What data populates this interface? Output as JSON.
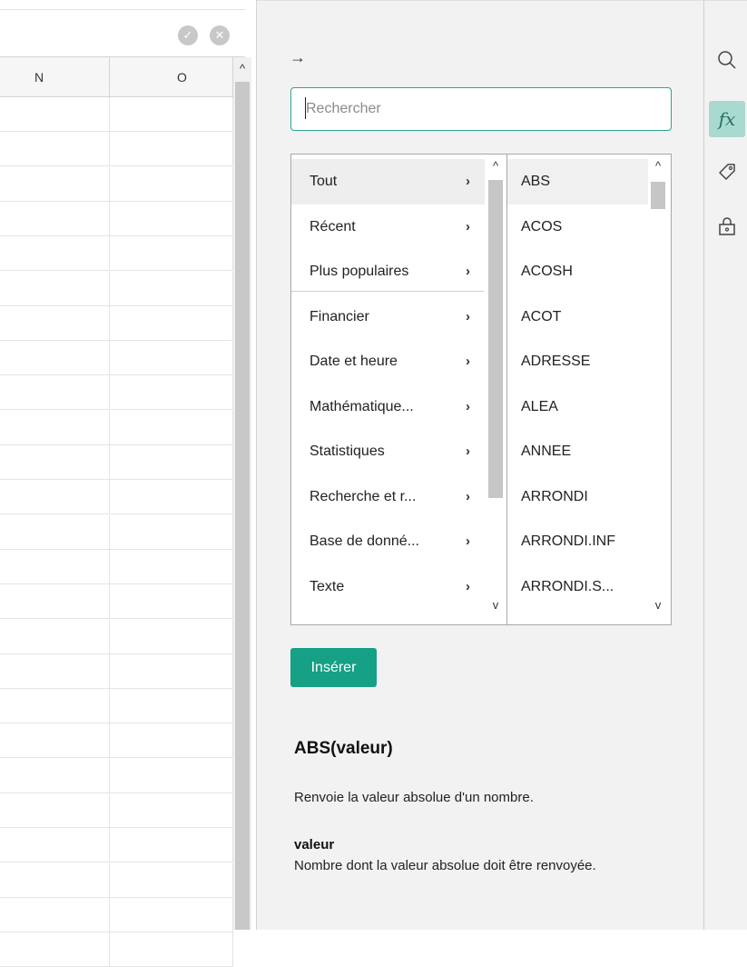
{
  "sheet": {
    "columns": [
      "N",
      "O"
    ]
  },
  "panel": {
    "collapse_icon": "→",
    "search": {
      "placeholder": "Rechercher",
      "value": ""
    },
    "categories": [
      {
        "label": "Tout",
        "selected": true
      },
      {
        "label": "Récent"
      },
      {
        "label": "Plus populaires"
      },
      {
        "label": "Financier"
      },
      {
        "label": "Date et heure"
      },
      {
        "label": "Mathématique..."
      },
      {
        "label": "Statistiques"
      },
      {
        "label": "Recherche et r..."
      },
      {
        "label": "Base de donné..."
      },
      {
        "label": "Texte"
      }
    ],
    "functions": [
      "ABS",
      "ACOS",
      "ACOSH",
      "ACOT",
      "ADRESSE",
      "ALEA",
      "ANNEE",
      "ARRONDI",
      "ARRONDI.INF",
      "ARRONDI.S..."
    ],
    "selected_function": "ABS",
    "insert_label": "Insérer",
    "details": {
      "signature": "ABS(valeur)",
      "description": "Renvoie la valeur absolue d'un nombre.",
      "param_name": "valeur",
      "param_description": "Nombre dont la valeur absolue doit être renvoyée."
    }
  },
  "toolbar": {
    "tools": [
      "search-icon",
      "function-fx-icon",
      "tag-icon",
      "lock-icon"
    ],
    "active_tool": "function-fx-icon"
  },
  "colors": {
    "accent": "#16a085",
    "active_tool_bg": "#a9d9cf"
  }
}
